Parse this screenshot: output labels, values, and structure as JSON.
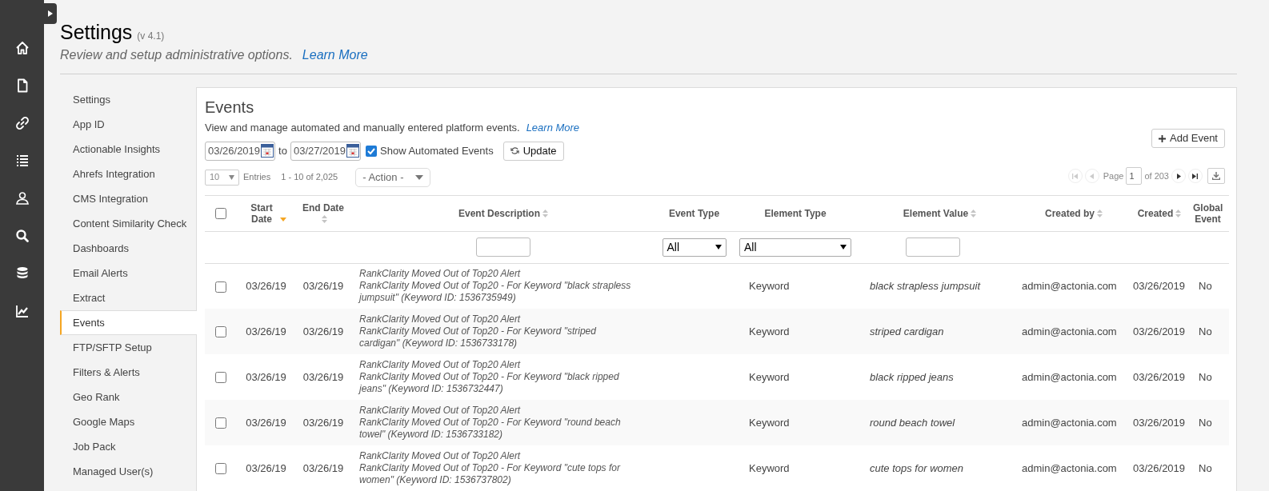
{
  "header": {
    "title": "Settings",
    "version": "(v 4.1)",
    "subtitle": "Review and setup administrative options.",
    "learn_more": "Learn More"
  },
  "settings_menu": [
    {
      "label": "Settings",
      "selected": false
    },
    {
      "label": "App ID",
      "selected": false
    },
    {
      "label": "Actionable Insights",
      "selected": false
    },
    {
      "label": "Ahrefs Integration",
      "selected": false
    },
    {
      "label": "CMS Integration",
      "selected": false
    },
    {
      "label": "Content Similarity Check",
      "selected": false
    },
    {
      "label": "Dashboards",
      "selected": false
    },
    {
      "label": "Email Alerts",
      "selected": false
    },
    {
      "label": "Extract",
      "selected": false
    },
    {
      "label": "Events",
      "selected": true
    },
    {
      "label": "FTP/SFTP Setup",
      "selected": false
    },
    {
      "label": "Filters & Alerts",
      "selected": false
    },
    {
      "label": "Geo Rank",
      "selected": false
    },
    {
      "label": "Google Maps",
      "selected": false
    },
    {
      "label": "Job Pack",
      "selected": false
    },
    {
      "label": "Managed User(s)",
      "selected": false
    }
  ],
  "panel": {
    "title": "Events",
    "description": "View and manage automated and manually entered platform events.",
    "learn_more": "Learn More",
    "add_button": "Add Event",
    "from_date": "03/26/2019",
    "to_label": "to",
    "to_date": "03/27/2019",
    "show_automated": {
      "label": "Show Automated Events",
      "checked": true
    },
    "update_button": "Update",
    "page_size": "10",
    "entries_label": "Entries",
    "range": "1 - 10 of 2,025",
    "action": "- Action -",
    "pagination": {
      "page_label": "Page",
      "page": "1",
      "of_label": "of 203"
    }
  },
  "table": {
    "select_all_checked": false,
    "columns": [
      {
        "label": "Start Date",
        "sortable": true,
        "sorted": true
      },
      {
        "label": "End Date",
        "sortable": true,
        "sorted": false
      },
      {
        "label": "Event Description",
        "sortable": true,
        "sorted": false
      },
      {
        "label": "Event Type",
        "sortable": false,
        "sorted": false
      },
      {
        "label": "Element Type",
        "sortable": false,
        "sorted": false
      },
      {
        "label": "Element Value",
        "sortable": true,
        "sorted": false
      },
      {
        "label": "Created by",
        "sortable": true,
        "sorted": false
      },
      {
        "label": "Created",
        "sortable": true,
        "sorted": false
      },
      {
        "label": "Global Event",
        "sortable": false,
        "sorted": false
      }
    ],
    "filters": {
      "event_type": "All",
      "element_type": "All"
    },
    "rows": [
      {
        "checked": false,
        "start": "03/26/19",
        "end": "03/26/19",
        "title": "RankClarity Moved Out of Top20 Alert",
        "detail": "RankClarity Moved Out of Top20 - For Keyword \"black strapless jumpsuit\" (Keyword ID: 1536735949)",
        "element_type": "Keyword",
        "element_value": "black strapless jumpsuit",
        "created_by": "admin@actonia.com",
        "created": "03/26/2019",
        "global": "No"
      },
      {
        "checked": false,
        "start": "03/26/19",
        "end": "03/26/19",
        "title": "RankClarity Moved Out of Top20 Alert",
        "detail": "RankClarity Moved Out of Top20 - For Keyword \"striped cardigan\" (Keyword ID: 1536733178)",
        "element_type": "Keyword",
        "element_value": "striped cardigan",
        "created_by": "admin@actonia.com",
        "created": "03/26/2019",
        "global": "No"
      },
      {
        "checked": false,
        "start": "03/26/19",
        "end": "03/26/19",
        "title": "RankClarity Moved Out of Top20 Alert",
        "detail": "RankClarity Moved Out of Top20 - For Keyword \"black ripped jeans\" (Keyword ID: 1536732447)",
        "element_type": "Keyword",
        "element_value": "black ripped jeans",
        "created_by": "admin@actonia.com",
        "created": "03/26/2019",
        "global": "No"
      },
      {
        "checked": false,
        "start": "03/26/19",
        "end": "03/26/19",
        "title": "RankClarity Moved Out of Top20 Alert",
        "detail": "RankClarity Moved Out of Top20 - For Keyword \"round beach towel\" (Keyword ID: 1536733182)",
        "element_type": "Keyword",
        "element_value": "round beach towel",
        "created_by": "admin@actonia.com",
        "created": "03/26/2019",
        "global": "No"
      },
      {
        "checked": false,
        "start": "03/26/19",
        "end": "03/26/19",
        "title": "RankClarity Moved Out of Top20 Alert",
        "detail": "RankClarity Moved Out of Top20 - For Keyword \"cute tops for women\" (Keyword ID: 1536737802)",
        "element_type": "Keyword",
        "element_value": "cute tops for women",
        "created_by": "admin@actonia.com",
        "created": "03/26/2019",
        "global": "No"
      }
    ]
  }
}
